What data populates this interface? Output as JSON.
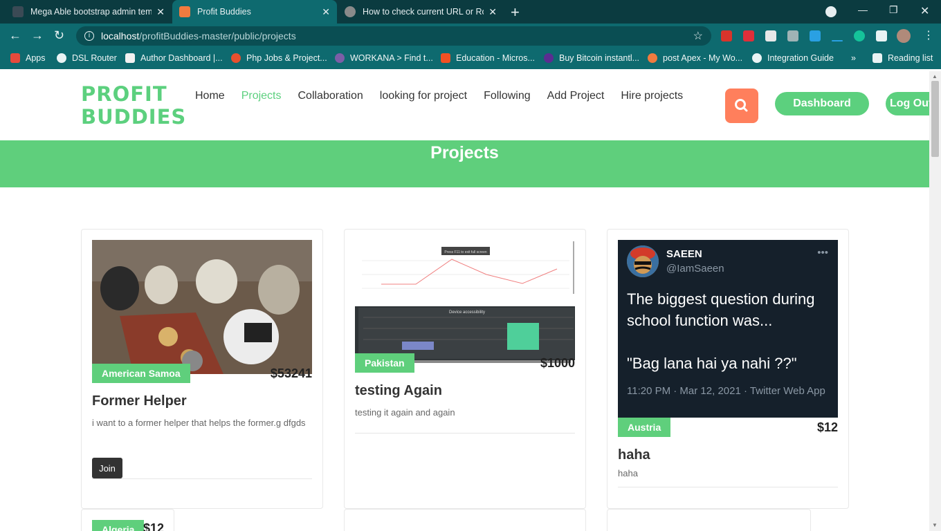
{
  "browser": {
    "tabs": [
      {
        "title": "Mega Able bootstrap admin tem",
        "color": "#3b4a55"
      },
      {
        "title": "Profit Buddies",
        "color": "#f07b3f"
      },
      {
        "title": "How to check current URL or Rou",
        "color": "#8a8a8a"
      }
    ],
    "url_host": "localhost",
    "url_path": "/profitBuddies-master/public/projects",
    "bookmarks": [
      {
        "label": "Apps"
      },
      {
        "label": "DSL Router"
      },
      {
        "label": "Author Dashboard |..."
      },
      {
        "label": "Php Jobs & Project..."
      },
      {
        "label": "WORKANA > Find t..."
      },
      {
        "label": "Education - Micros..."
      },
      {
        "label": "Buy Bitcoin instantl..."
      },
      {
        "label": "post Apex - My Wo..."
      },
      {
        "label": "Integration Guide"
      }
    ],
    "more_bookmarks": "»",
    "reading_list": "Reading list"
  },
  "site": {
    "logo_line1": "PROFIT",
    "logo_line2": "BUDDIES",
    "nav": [
      "Home",
      "Projects",
      "Collaboration",
      "looking for project",
      "Following",
      "Add Project",
      "Hire projects"
    ],
    "dashboard_label": "Dashboard",
    "logout_label": "Log Out",
    "page_title": "Projects"
  },
  "projects": [
    {
      "country": "American Samoa",
      "price": "$53241",
      "title": "Former Helper",
      "description": "i want to a former helper that helps the former.g dfgds",
      "join_label": "Join"
    },
    {
      "country": "Pakistan",
      "price": "$1000",
      "title": "testing Again",
      "description": "testing it again and again",
      "image_chart_title": "Device accessibility",
      "image_hint": "Press F11 to exit full screen"
    },
    {
      "country": "Austria",
      "price": "$12",
      "title": "haha",
      "description": "haha",
      "tweet": {
        "name": "SAEEN",
        "handle": "@IamSaeen",
        "text_line1": "The biggest question during school function was...",
        "text_line2": "\"Bag lana hai ya nahi ??\"",
        "meta": "11:20 PM · Mar 12, 2021 · Twitter Web App"
      }
    }
  ],
  "partial_next": {
    "country": "Algeria",
    "price": "$12"
  }
}
